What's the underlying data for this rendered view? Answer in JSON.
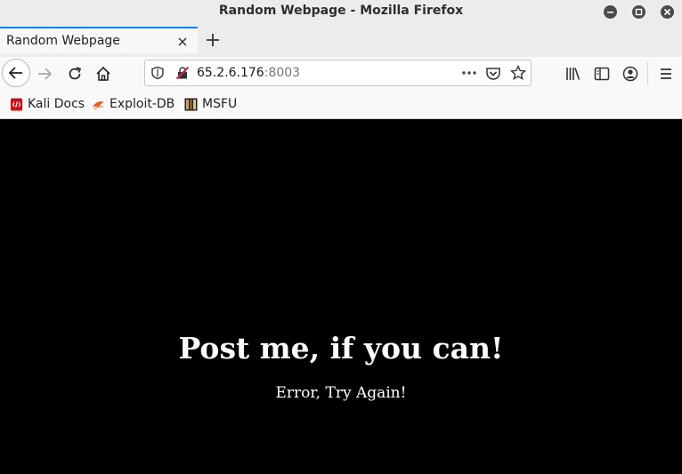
{
  "window": {
    "title": "Random Webpage - Mozilla Firefox"
  },
  "tabs": [
    {
      "label": "Random Webpage",
      "active": true
    }
  ],
  "navbar": {
    "url_host": "65.2.6.176",
    "url_port": ":8003"
  },
  "bookmarks": [
    {
      "label": "Kali Docs",
      "icon": "kali-docs-icon",
      "color": "#c4161c"
    },
    {
      "label": "Exploit-DB",
      "icon": "exploit-db-icon",
      "color": "#e85d1f"
    },
    {
      "label": "MSFU",
      "icon": "msfu-icon",
      "color": "#3a2a1a"
    }
  ],
  "page": {
    "heading": "Post me, if you can!",
    "message": "Error, Try Again!",
    "background": "#000000",
    "text_color": "#ffffff"
  },
  "colors": {
    "accent": "#0a84ff"
  }
}
